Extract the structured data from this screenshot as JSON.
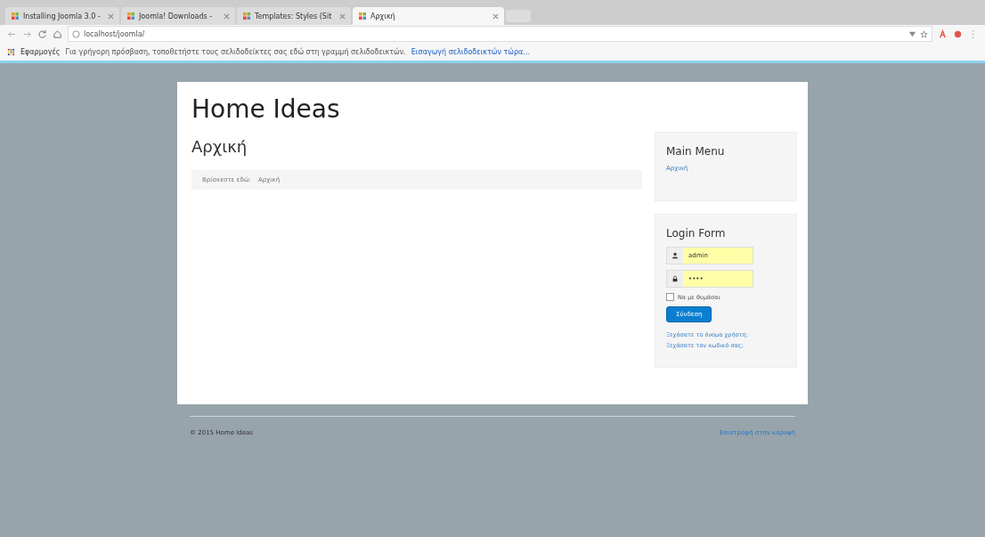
{
  "browser": {
    "tabs": [
      {
        "label": "Installing Joomla 3.0 -",
        "selected": false
      },
      {
        "label": "Joomla! Downloads -",
        "selected": false
      },
      {
        "label": "Templates: Styles (Sit",
        "selected": false
      },
      {
        "label": "Αρχική",
        "selected": true
      }
    ],
    "address": "localhost/joomla/",
    "bookmarks": {
      "apps": "Εφαρμογές",
      "hint": "Για γρήγορη πρόσβαση, τοποθετήστε τους σελιδοδείκτες σας εδώ στη γραμμή σελιδοδεικτών.",
      "import_link": "Εισαγωγή σελιδοδεικτών τώρα..."
    }
  },
  "site": {
    "title": "Home Ideas",
    "page_heading": "Αρχική",
    "breadcrumb": {
      "label": "Βρίσκεστε εδώ:",
      "current": "Αρχική"
    },
    "main_menu": {
      "title": "Main Menu",
      "items": [
        "Αρχική"
      ]
    },
    "login": {
      "title": "Login Form",
      "username": "admin",
      "password": "••••",
      "remember": {
        "label": "Να με θυμάσαι",
        "checked": false
      },
      "submit": "Σύνδεση",
      "links": [
        "Ξεχάσατε το όνομα χρήστη;",
        "Ξεχάσατε τον κωδικό σας;"
      ]
    },
    "footer": {
      "copyright": "© 2015 Home Ideas",
      "back_to_top": "Επιστροφή στην κορυφή"
    }
  }
}
